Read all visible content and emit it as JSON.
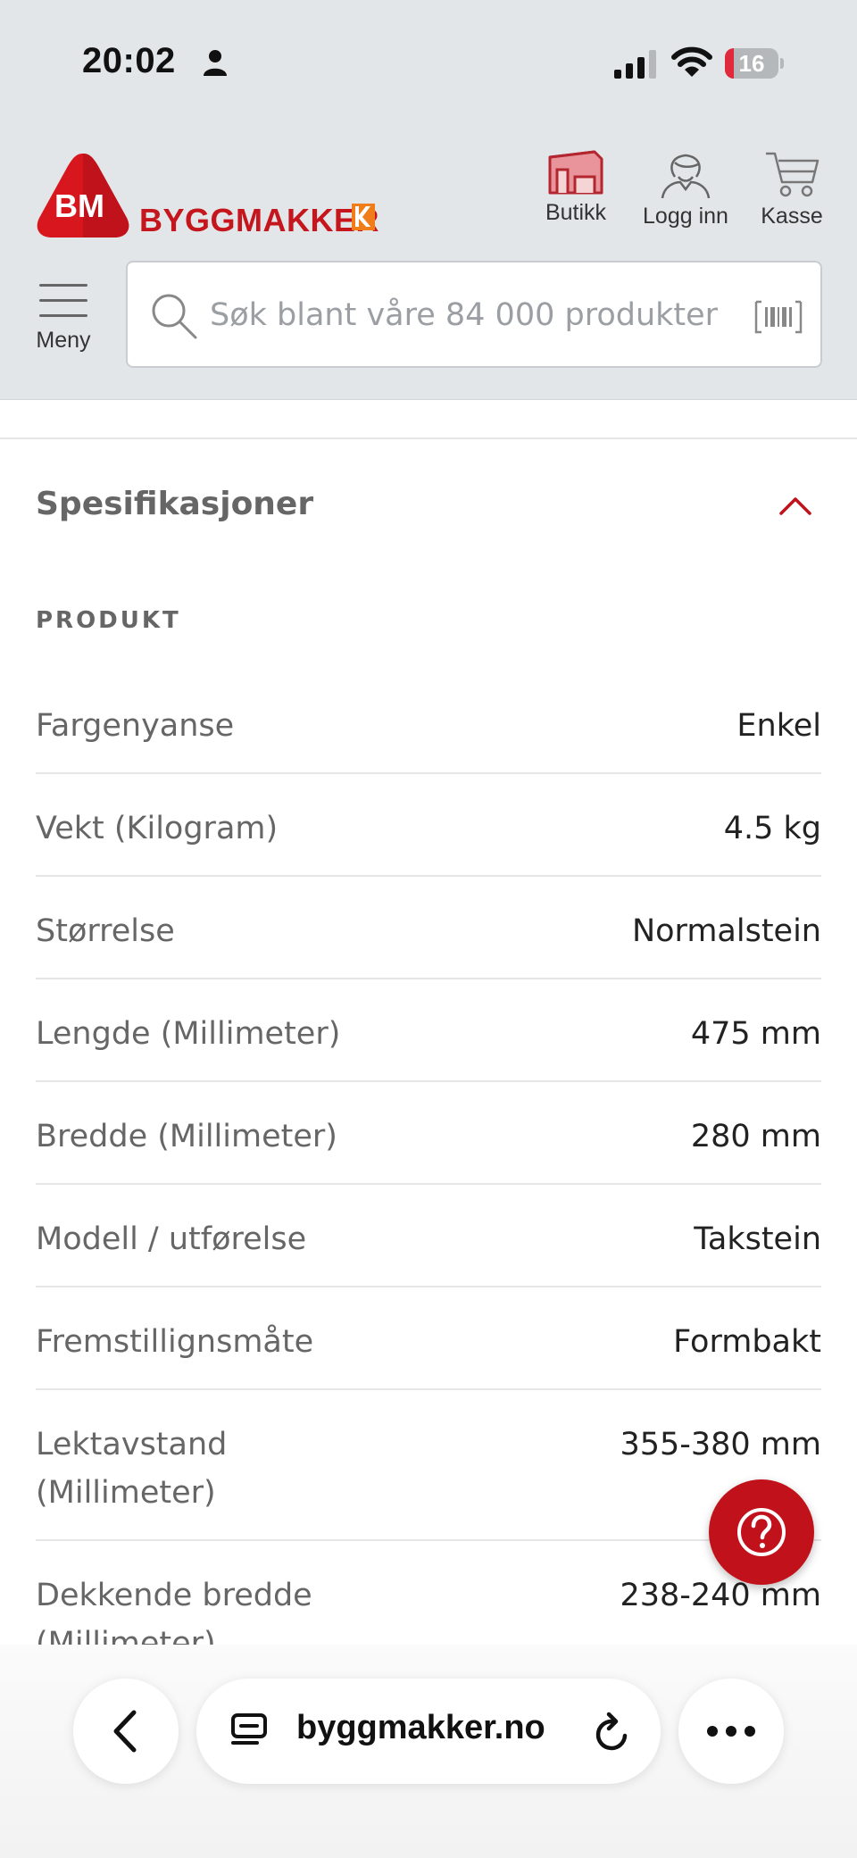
{
  "status_bar": {
    "time": "20:02",
    "battery_level": "16",
    "battery_fraction": 0.16,
    "battery_color": "#e0293a"
  },
  "header": {
    "brand_badge": "BM",
    "brand_name": "BYGGMAKKER",
    "brand_color": "#c4161c",
    "actions": [
      {
        "label": "Butikk",
        "icon": "store-icon"
      },
      {
        "label": "Logg inn",
        "icon": "user-icon"
      },
      {
        "label": "Kasse",
        "icon": "cart-icon"
      }
    ],
    "menu_label": "Meny",
    "search": {
      "placeholder": "Søk blant våre 84 000 produkter",
      "value": ""
    }
  },
  "specifications": {
    "title": "Spesifikasjoner",
    "section": "PRODUKT",
    "rows": [
      {
        "key": "Fargenyanse",
        "value": "Enkel"
      },
      {
        "key": "Vekt (Kilogram)",
        "value": "4.5 kg"
      },
      {
        "key": "Størrelse",
        "value": "Normalstein"
      },
      {
        "key": "Lengde (Millimeter)",
        "value": "475 mm"
      },
      {
        "key": "Bredde (Millimeter)",
        "value": "280 mm"
      },
      {
        "key": "Modell / utførelse",
        "value": "Takstein"
      },
      {
        "key": "Fremstillignsmåte",
        "value": "Formbakt"
      },
      {
        "key": "Lektavstand (Millimeter)",
        "value": "355-380 mm"
      },
      {
        "key": "Dekkende bredde (Millimeter)",
        "value": "238-240 mm"
      }
    ]
  },
  "help": {
    "icon": "question-icon",
    "color": "#c1121c"
  },
  "browser": {
    "url": "byggmakker.no"
  }
}
